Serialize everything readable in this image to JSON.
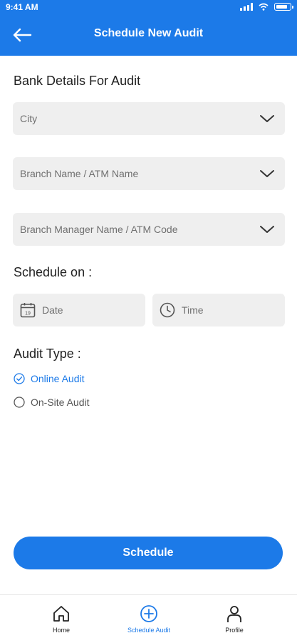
{
  "status_bar": {
    "time": "9:41 AM"
  },
  "header": {
    "title": "Schedule New Audit"
  },
  "bank_details": {
    "heading": "Bank Details For Audit",
    "city_placeholder": "City",
    "branch_placeholder": "Branch Name / ATM Name",
    "manager_placeholder": "Branch Manager Name / ATM Code"
  },
  "schedule": {
    "heading": "Schedule on :",
    "date_placeholder": "Date",
    "calendar_day": "19",
    "time_placeholder": "Time"
  },
  "audit_type": {
    "heading": "Audit Type :",
    "options": [
      {
        "label": "Online Audit",
        "selected": true
      },
      {
        "label": "On-Site Audit",
        "selected": false
      }
    ]
  },
  "actions": {
    "schedule_label": "Schedule"
  },
  "bottom_nav": {
    "items": [
      {
        "label": "Home",
        "icon": "home-icon",
        "active": false
      },
      {
        "label": "Schedule Audit",
        "icon": "plus-circle-icon",
        "active": true
      },
      {
        "label": "Profile",
        "icon": "person-icon",
        "active": false
      }
    ]
  },
  "colors": {
    "accent": "#1c7ae8",
    "field_bg": "#efefef",
    "placeholder": "#707070"
  }
}
